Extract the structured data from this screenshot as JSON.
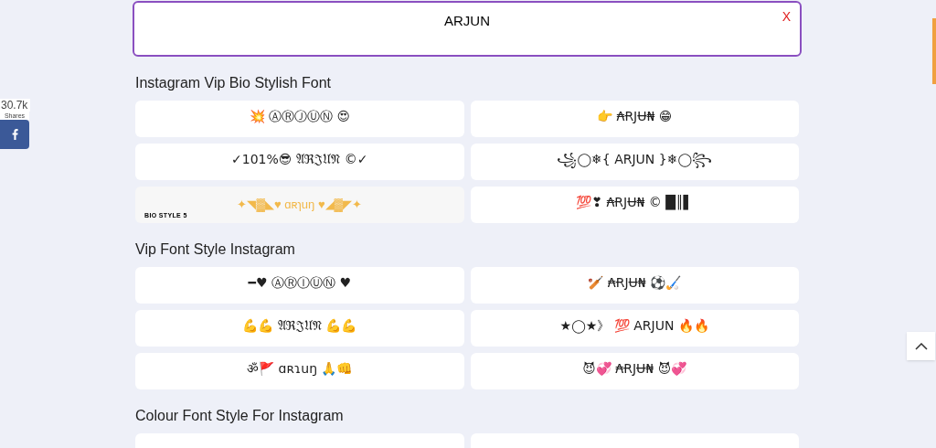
{
  "input": {
    "value": "ARJUN",
    "clear": "X"
  },
  "share": {
    "count": "30.7k",
    "label": "Shares"
  },
  "sections": [
    {
      "title": "Instagram Vip Bio Stylish Font",
      "cards": [
        {
          "kind": "text",
          "text": "💥 ⒶⓇⒿⓊⓃ 😍"
        },
        {
          "kind": "text",
          "text": "👉 ₳ɌJɄ₦ 😁"
        },
        {
          "kind": "text",
          "text": "✓101%😎 𝔄ℜ𝔍𝔘𝔑 ©✓"
        },
        {
          "kind": "text",
          "text": "꧁◯❄{ ARJUN }❄◯꧂"
        },
        {
          "kind": "image",
          "text": "✦◥▓◣♥ ɑʀɿuŋ ♥◢▓◤✦",
          "label": "BIO STYLE 5"
        },
        {
          "kind": "text",
          "text": "💯❣ ₳ɌJɄ₦ © █║▌"
        }
      ]
    },
    {
      "title": "Vip Font Style Instagram",
      "cards": [
        {
          "kind": "text",
          "text": "━♥ ⒶⓇⒾⓊⓃ ♥"
        },
        {
          "kind": "text",
          "text": "🏏 ₳ɌJɄ₦ ⚽🏑"
        },
        {
          "kind": "text",
          "text": "💪💪 𝔄ℜ𝔍𝔘𝔑 💪💪"
        },
        {
          "kind": "text",
          "text": "★◯★》 💯 ARJUN 🔥🔥"
        },
        {
          "kind": "text",
          "text": "ॐ🚩 ɑʀɿuŋ 🙏👊"
        },
        {
          "kind": "text",
          "text": "😈💞 ₳ɌJɄ₦ 😈💞"
        }
      ]
    },
    {
      "title": "Colour Font Style For Instagram",
      "cards": [
        {
          "kind": "empty"
        },
        {
          "kind": "empty"
        }
      ]
    }
  ]
}
